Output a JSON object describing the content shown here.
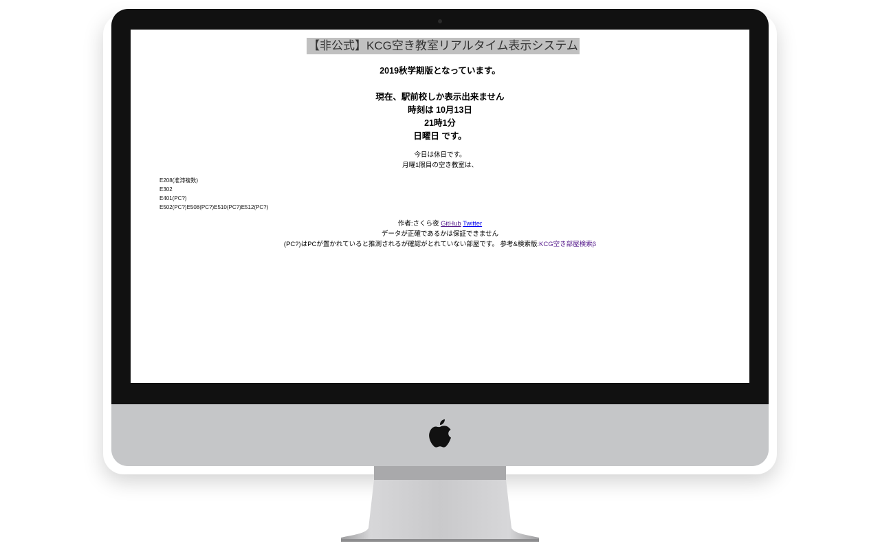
{
  "page": {
    "title": "【非公式】KCG空き教室リアルタイム表示システム",
    "version_note": "2019秋学期版となっています。",
    "campus_note": "現在、駅前校しか表示出来ません",
    "time_line": "時刻は 10月13日",
    "time_hm": "21時1分",
    "weekday_line": "日曜日 です。",
    "holiday_note": "今日は休日です。",
    "period_note": "月曜1限目の空き教室は、"
  },
  "rooms": [
    "E208(准滞複数)",
    "E302",
    "E401(PC?)",
    "E502(PC?)E508(PC?)E510(PC?)E512(PC?)"
  ],
  "footer": {
    "author_prefix": "作者:さくら夜",
    "github_label": "GitHub",
    "twitter_label": "Twitter",
    "accuracy_note": "データが正確であるかは保証できません",
    "pc_note": "(PC?)はPCが置かれていると推測されるが確認がとれていない部屋です。 参考&検索版:",
    "search_link_label": "KCG空き部屋検索β"
  },
  "colors": {
    "title_bg": "#c0c0c0",
    "link_visited": "#551a8b",
    "link": "#0000ee",
    "bezel": "#111111",
    "chin": "#c5c6c8"
  },
  "icons": {
    "brand_logo": "apple-logo-icon"
  }
}
